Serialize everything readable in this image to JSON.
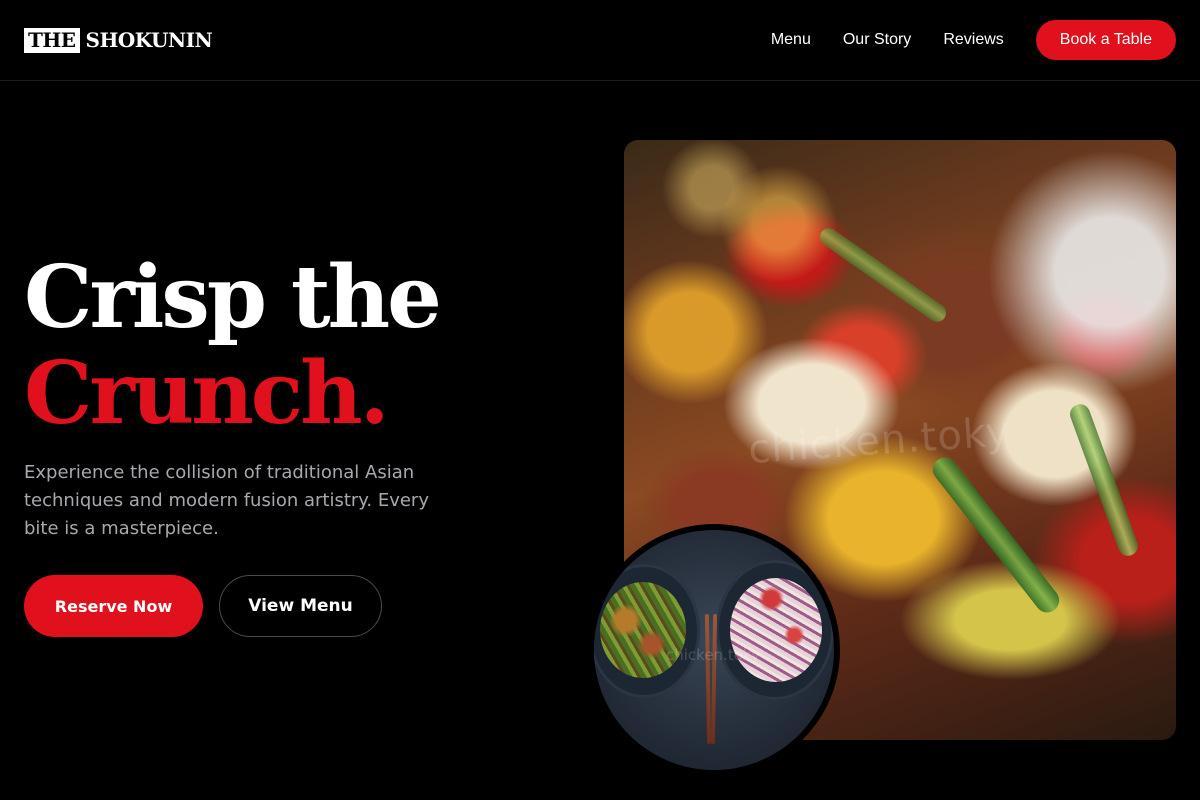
{
  "brand": {
    "logo_box": "THE",
    "logo_text": "SHOKUNIN"
  },
  "nav": {
    "links": [
      "Menu",
      "Our Story",
      "Reviews"
    ],
    "cta": "Book a Table"
  },
  "hero": {
    "title_line1": "Crisp the",
    "title_line2": "Crunch.",
    "subtitle": "Experience the collision of traditional Asian techniques and modern fusion artistry. Every bite is a masterpiece.",
    "primary_button": "Reserve Now",
    "secondary_button": "View Menu"
  },
  "images": {
    "main_watermark": "chicken.toky",
    "circle_watermark": "chicken.toky"
  },
  "colors": {
    "accent": "#e0101c",
    "background": "#000000",
    "text_primary": "#ffffff",
    "text_muted": "#a8a8ae"
  }
}
